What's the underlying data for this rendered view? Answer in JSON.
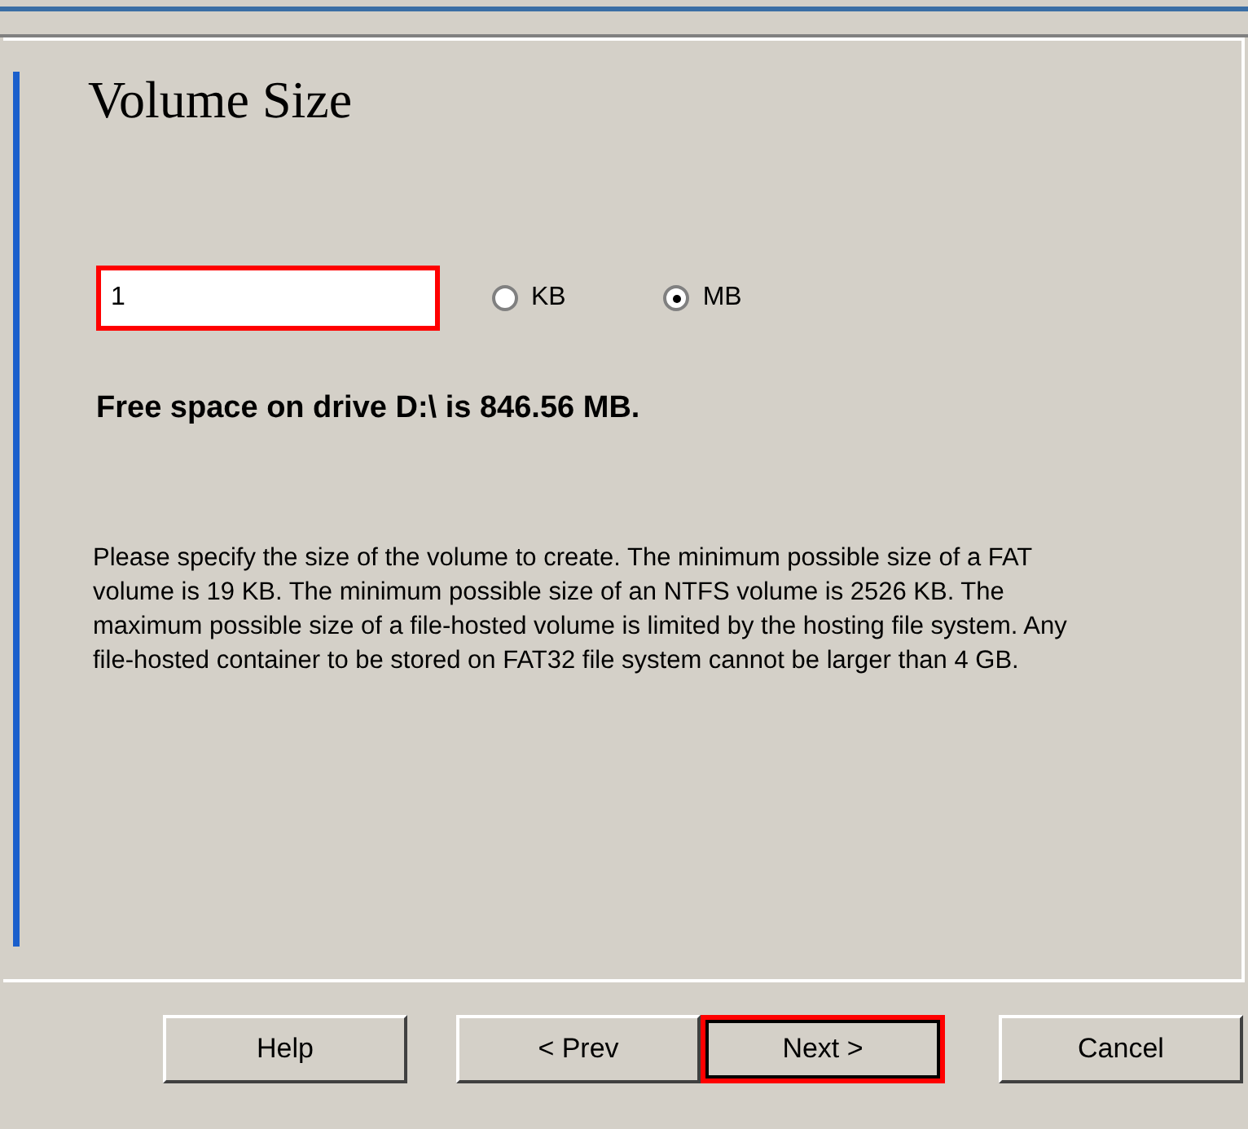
{
  "title": "Volume Size",
  "size_field": {
    "value": "1",
    "highlighted": true
  },
  "units": [
    {
      "label": "KB",
      "selected": false
    },
    {
      "label": "MB",
      "selected": true
    }
  ],
  "free_space": "Free space on drive D:\\ is 846.56 MB.",
  "description": "Please specify the size of the volume to create. The minimum possible size of a FAT volume is 19 KB. The minimum possible size of an NTFS volume is 2526 KB. The maximum possible size of a file-hosted volume is limited by the hosting file system. Any file-hosted container to be stored on FAT32 file system cannot be larger than 4 GB.",
  "buttons": [
    {
      "label": "Help",
      "highlighted": false
    },
    {
      "label": "< Prev",
      "highlighted": false
    },
    {
      "label": "Next >",
      "highlighted": true
    },
    {
      "label": "Cancel",
      "highlighted": false
    }
  ]
}
